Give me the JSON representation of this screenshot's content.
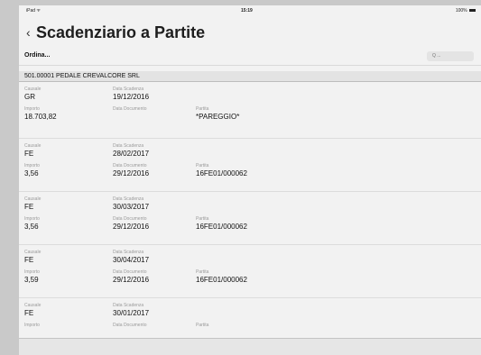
{
  "status_bar": {
    "carrier": "iPad ᯤ",
    "time": "15:19",
    "battery": "100%"
  },
  "header": {
    "title": "Scadenziario a Partite"
  },
  "toolbar": {
    "sort_label": "Ordina...",
    "search_placeholder": "Q ..."
  },
  "customer": {
    "label": "501.00001 PEDALE CREVALCORE SRL"
  },
  "labels": {
    "causale": "Causale",
    "data_scadenza": "Data Scadenza",
    "importo": "Importo",
    "data_documento": "Data Documento",
    "partita": "Partita"
  },
  "rows": [
    {
      "causale": "GR",
      "data_scadenza": "19/12/2016",
      "importo": "18.703,82",
      "data_documento": "",
      "partita": "*PAREGGIO*"
    },
    {
      "causale": "FE",
      "data_scadenza": "28/02/2017",
      "importo": "3,56",
      "data_documento": "29/12/2016",
      "partita": "16FE01/000062"
    },
    {
      "causale": "FE",
      "data_scadenza": "30/03/2017",
      "importo": "3,56",
      "data_documento": "29/12/2016",
      "partita": "16FE01/000062"
    },
    {
      "causale": "FE",
      "data_scadenza": "30/04/2017",
      "importo": "3,59",
      "data_documento": "29/12/2016",
      "partita": "16FE01/000062"
    },
    {
      "causale": "FE",
      "data_scadenza": "30/01/2017",
      "importo": "",
      "data_documento": "",
      "partita": ""
    }
  ]
}
